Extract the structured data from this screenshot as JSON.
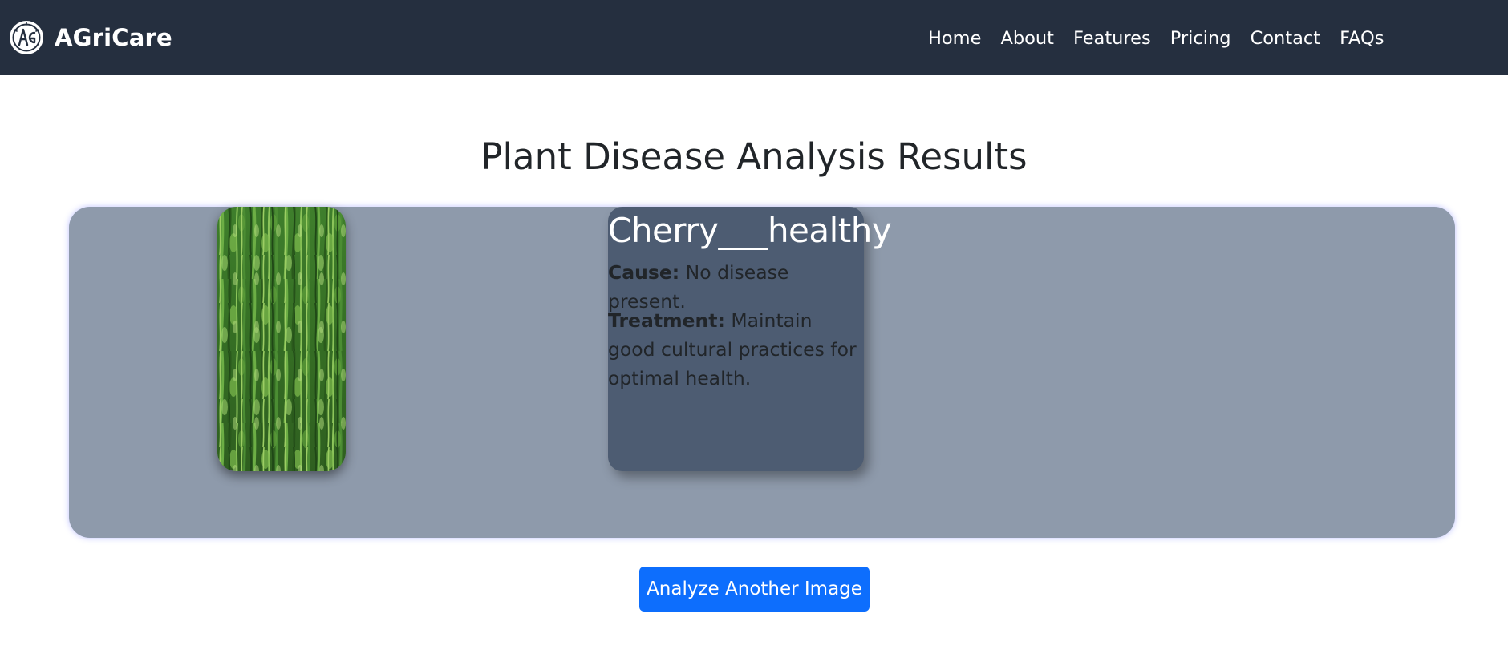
{
  "brand": {
    "name": "AGriCare",
    "logo_icon": "agricare-logo-icon"
  },
  "nav": {
    "items": [
      "Home",
      "About",
      "Features",
      "Pricing",
      "Contact",
      "FAQs"
    ]
  },
  "page": {
    "title": "Plant Disease Analysis Results"
  },
  "result": {
    "disease_name": "Cherry___healthy",
    "cause_label": "Cause:",
    "cause_text": "No disease present.",
    "treatment_label": "Treatment:",
    "treatment_text": "Maintain good cultural practices for optimal health."
  },
  "actions": {
    "analyze_another_label": "Analyze Another Image"
  },
  "colors": {
    "navbar_bg": "#252f3f",
    "panel_bg": "#8e9aab",
    "card_bg": "#4d5c72",
    "button_bg": "#0d6efd",
    "text_dark": "#212529"
  }
}
